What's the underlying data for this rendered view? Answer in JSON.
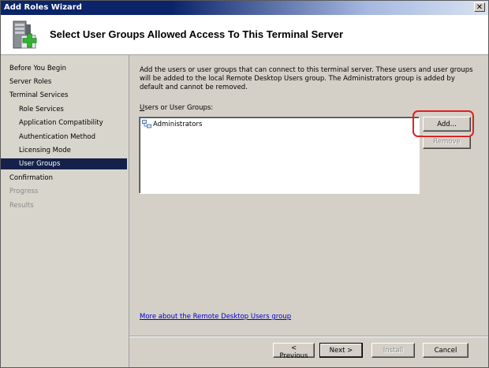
{
  "window": {
    "title": "Add Roles Wizard",
    "close_glyph": "✕"
  },
  "header": {
    "title": "Select User Groups Allowed Access To This Terminal Server"
  },
  "sidebar": {
    "items": [
      {
        "label": "Before You Begin",
        "level": "top",
        "state": "normal"
      },
      {
        "label": "Server Roles",
        "level": "top",
        "state": "normal"
      },
      {
        "label": "Terminal Services",
        "level": "top",
        "state": "normal"
      },
      {
        "label": "Role Services",
        "level": "sub",
        "state": "normal"
      },
      {
        "label": "Application Compatibility",
        "level": "sub",
        "state": "normal"
      },
      {
        "label": "Authentication Method",
        "level": "sub",
        "state": "normal"
      },
      {
        "label": "Licensing Mode",
        "level": "sub",
        "state": "normal"
      },
      {
        "label": "User Groups",
        "level": "sub",
        "state": "active"
      },
      {
        "label": "Confirmation",
        "level": "top",
        "state": "normal"
      },
      {
        "label": "Progress",
        "level": "top",
        "state": "disabled"
      },
      {
        "label": "Results",
        "level": "top",
        "state": "disabled"
      }
    ]
  },
  "main": {
    "description": "Add the users or user groups that can connect to this terminal server. These users and user groups will be added to the local Remote Desktop Users group. The Administrators group is added by default and cannot be removed.",
    "list_label": "Users or User Groups:",
    "list_items": [
      "Administrators"
    ],
    "add_button": "Add...",
    "remove_button": "Remove",
    "more_link": "More about the Remote Desktop Users group"
  },
  "footer": {
    "previous": "< Previous",
    "next": "Next >",
    "install": "Install",
    "cancel": "Cancel"
  }
}
